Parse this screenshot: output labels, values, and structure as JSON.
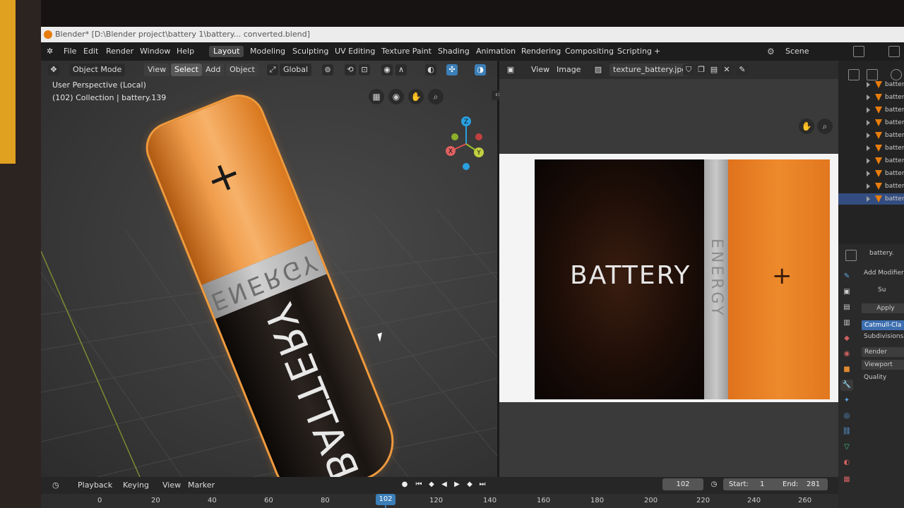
{
  "window": {
    "title": "Blender* [D:\\Blender project\\battery 1\\battery... converted.blend]"
  },
  "menu": [
    "File",
    "Edit",
    "Render",
    "Window",
    "Help"
  ],
  "workspaces": [
    "Layout",
    "Modeling",
    "Sculpting",
    "UV Editing",
    "Texture Paint",
    "Shading",
    "Animation",
    "Rendering",
    "Compositing",
    "Scripting",
    "+"
  ],
  "scene": "Scene",
  "viewport": {
    "mode": "Object Mode",
    "menus": [
      "View",
      "Select",
      "Add",
      "Object"
    ],
    "orientation": "Global",
    "overlay_line1": "User Perspective (Local)",
    "overlay_line2": "(102) Collection | battery.139",
    "battery": {
      "plus": "+",
      "band": "ENERGY",
      "label": "BATTERY"
    },
    "gizmo": {
      "z": "Z",
      "y": "Y",
      "x": "X"
    }
  },
  "image_editor": {
    "menus": [
      "View",
      "Image"
    ],
    "image_name": "texture_battery.jpg",
    "texture": {
      "label": "BATTERY",
      "band": "ENERGY",
      "plus": "+"
    }
  },
  "outliner": {
    "items": [
      "batter",
      "batter",
      "batter",
      "batter",
      "batter",
      "batter",
      "batter",
      "batter",
      "batter",
      "batter"
    ]
  },
  "properties": {
    "object": "battery.",
    "add_modifier": "Add Modifier",
    "modifier": "Su",
    "apply": "Apply",
    "catmull": "Catmull-Cla",
    "subdivisions": "Subdivisions",
    "render": "Render",
    "viewport": "Viewport",
    "quality": "Quality"
  },
  "timeline": {
    "menus": [
      "Playback",
      "Keying",
      "View",
      "Marker"
    ],
    "current_frame": "102",
    "start_label": "Start:",
    "start": "1",
    "end_label": "End:",
    "end": "281",
    "ticks": [
      "0",
      "20",
      "40",
      "60",
      "80",
      "102",
      "120",
      "140",
      "160",
      "180",
      "200",
      "220",
      "240",
      "260"
    ]
  }
}
